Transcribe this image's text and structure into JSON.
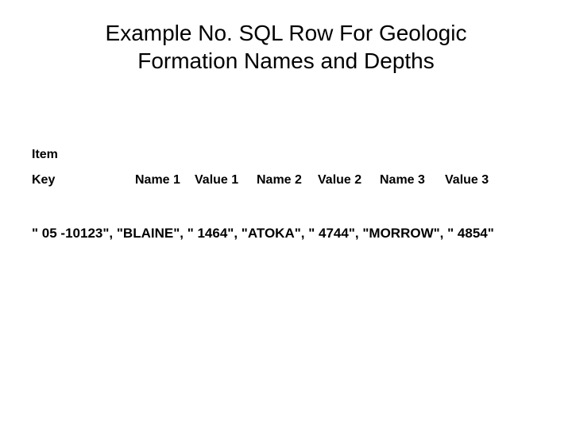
{
  "title_line1": "Example No. SQL Row For Geologic",
  "title_line2": "Formation Names and Depths",
  "item_label": "Item",
  "headers": {
    "key": "Key",
    "name1": "Name 1",
    "value1": "Value 1",
    "name2": "Name 2",
    "value2": "Value 2",
    "name3": "Name 3",
    "value3": "Value 3"
  },
  "row_text": "\" 05 -10123\", \"BLAINE\", \" 1464\", \"ATOKA\", \" 4744\", \"MORROW\", \" 4854\"",
  "row": {
    "key": "05 -10123",
    "name1": "BLAINE",
    "value1": "1464",
    "name2": "ATOKA",
    "value2": "4744",
    "name3": "MORROW",
    "value3": "4854"
  }
}
